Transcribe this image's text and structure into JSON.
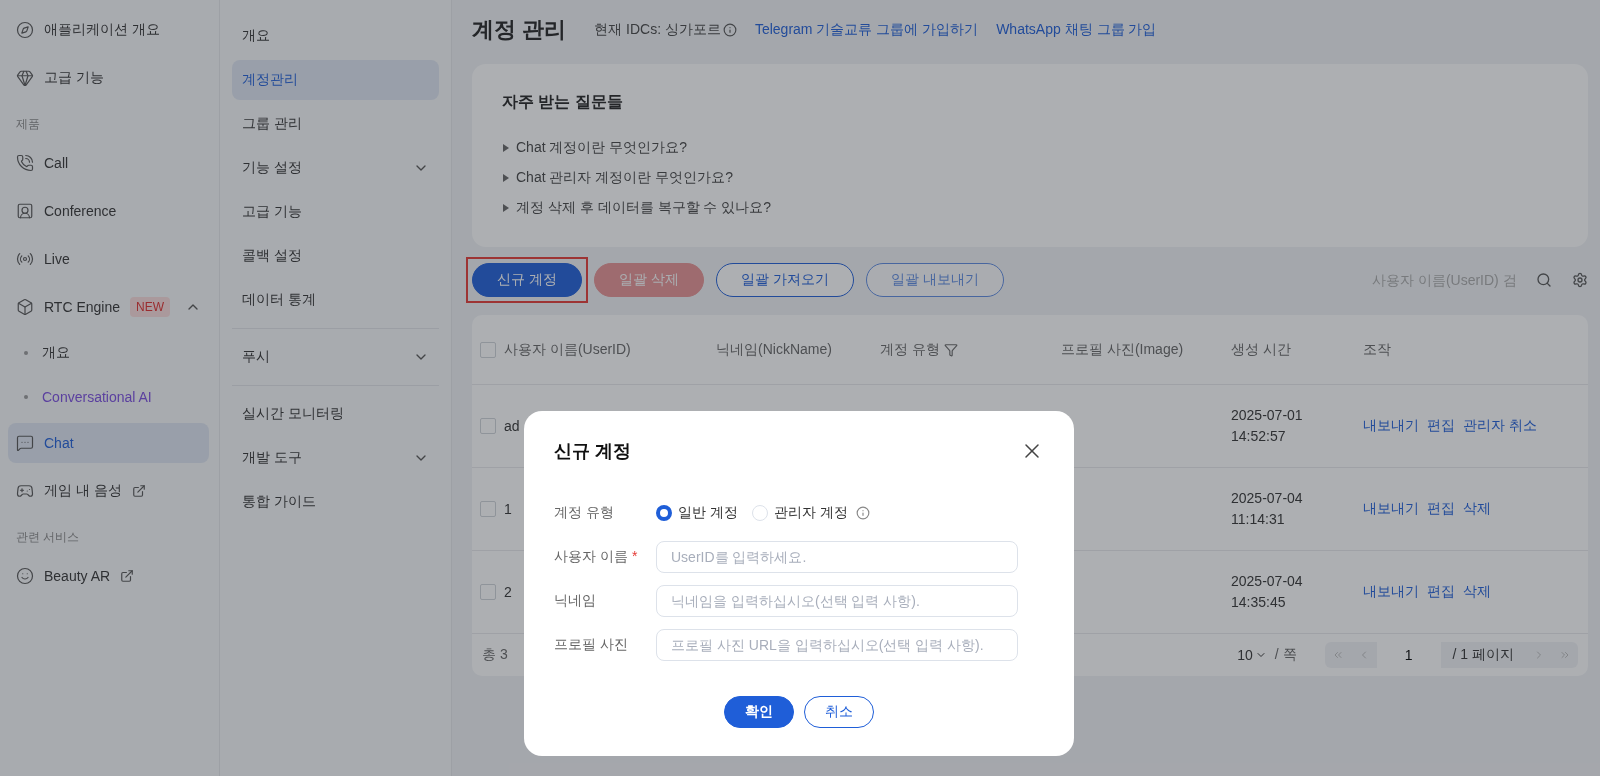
{
  "sidebar": {
    "items": [
      {
        "kind": "item",
        "label": "애플리케이션 개요",
        "selected": false
      },
      {
        "kind": "item",
        "label": "고급 기능",
        "selected": false
      },
      {
        "kind": "section",
        "label": "제품"
      },
      {
        "kind": "item",
        "label": "Call",
        "selected": false
      },
      {
        "kind": "item",
        "label": "Conference",
        "selected": false
      },
      {
        "kind": "item",
        "label": "Live",
        "selected": false
      },
      {
        "kind": "item",
        "label": "RTC Engine",
        "badge": "NEW",
        "expanded": true,
        "selected": false,
        "children": [
          {
            "label": "개요",
            "selected": false
          },
          {
            "label": "Conversational AI",
            "selected": true
          }
        ]
      },
      {
        "kind": "item",
        "label": "Chat",
        "selected": true
      },
      {
        "kind": "item",
        "label": "게임 내 음성",
        "external": true,
        "selected": false
      },
      {
        "kind": "section",
        "label": "관련 서비스"
      },
      {
        "kind": "item",
        "label": "Beauty AR",
        "external": true,
        "selected": false
      }
    ]
  },
  "subnav": {
    "groups": [
      [
        {
          "label": "개요",
          "selected": false,
          "expandable": false
        },
        {
          "label": "계정관리",
          "selected": true,
          "expandable": false
        },
        {
          "label": "그룹 관리",
          "selected": false,
          "expandable": false
        },
        {
          "label": "기능 설정",
          "selected": false,
          "expandable": true
        },
        {
          "label": "고급 기능",
          "selected": false,
          "expandable": false
        },
        {
          "label": "콜백 설정",
          "selected": false,
          "expandable": false
        },
        {
          "label": "데이터 통계",
          "selected": false,
          "expandable": false
        }
      ],
      [
        {
          "label": "푸시",
          "selected": false,
          "expandable": true
        }
      ],
      [
        {
          "label": "실시간 모니터링",
          "selected": false,
          "expandable": false
        },
        {
          "label": "개발 도구",
          "selected": false,
          "expandable": true
        },
        {
          "label": "통합 가이드",
          "selected": false,
          "expandable": false
        }
      ]
    ]
  },
  "header": {
    "title": "계정 관리",
    "idc": "현재 IDCs: 싱가포르",
    "links": [
      "Telegram 기술교류 그룹에 가입하기",
      "WhatsApp 채팅 그룹 가입"
    ]
  },
  "faq": {
    "title": "자주 받는 질문들",
    "items": [
      "Chat 계정이란 무엇인가요?",
      "Chat 관리자 계정이란 무엇인가요?",
      "계정 삭제 후 데이터를 복구할 수 있나요?"
    ]
  },
  "toolbar": {
    "buttons": [
      {
        "label": "신규 계정",
        "kind": "primary",
        "disabled": false,
        "highlighted": true
      },
      {
        "label": "일괄 삭제",
        "kind": "danger",
        "disabled": true,
        "highlighted": false
      },
      {
        "label": "일괄 가져오기",
        "kind": "outline",
        "disabled": false,
        "highlighted": false
      },
      {
        "label": "일괄 내보내기",
        "kind": "outline",
        "disabled": true,
        "highlighted": false
      }
    ],
    "search": {
      "placeholder": "사용자 이름(UserID) 검"
    }
  },
  "table": {
    "all_checked": false,
    "columns": [
      {
        "label": "사용자 이름(UserID)",
        "filter": false
      },
      {
        "label": "닉네임(NickName)",
        "filter": false
      },
      {
        "label": "계정 유형",
        "filter": true
      },
      {
        "label": "프로필 사진(Image)",
        "filter": false
      },
      {
        "label": "생성 시간",
        "filter": false
      },
      {
        "label": "조작",
        "filter": false
      }
    ],
    "rows": [
      {
        "checked": false,
        "userid": "ad",
        "created": [
          "2025-07-01",
          "14:52:57"
        ],
        "actions": [
          "내보내기",
          "편집",
          "관리자 취소"
        ]
      },
      {
        "checked": false,
        "userid": "1",
        "created": [
          "2025-07-04",
          "11:14:31"
        ],
        "actions": [
          "내보내기",
          "편집",
          "삭제"
        ]
      },
      {
        "checked": false,
        "userid": "2",
        "created": [
          "2025-07-04",
          "14:35:45"
        ],
        "actions": [
          "내보내기",
          "편집",
          "삭제"
        ]
      }
    ],
    "total": "총 3",
    "pagination": {
      "page_size": "10",
      "per": "/ 쪽",
      "page": "1",
      "pages": "/ 1 페이지"
    }
  },
  "modal": {
    "title": "신규 계정",
    "fields": [
      {
        "kind": "radio",
        "label": "계정 유형",
        "options": [
          {
            "label": "일반 계정",
            "selected": true
          },
          {
            "label": "관리자 계정",
            "selected": false
          }
        ]
      },
      {
        "kind": "input",
        "label": "사용자 이름",
        "required_mark": "*",
        "placeholder": "UserID를 입력하세요."
      },
      {
        "kind": "input",
        "label": "닉네임",
        "placeholder": "닉네임을 입력하십시오(선택 입력 사항)."
      },
      {
        "kind": "input",
        "label": "프로필 사진",
        "placeholder": "프로필 사진 URL을 입력하십시오(선택 입력 사항)."
      }
    ],
    "buttons": [
      {
        "label": "확인",
        "kind": "primary"
      },
      {
        "label": "취소",
        "kind": "outline"
      }
    ]
  }
}
